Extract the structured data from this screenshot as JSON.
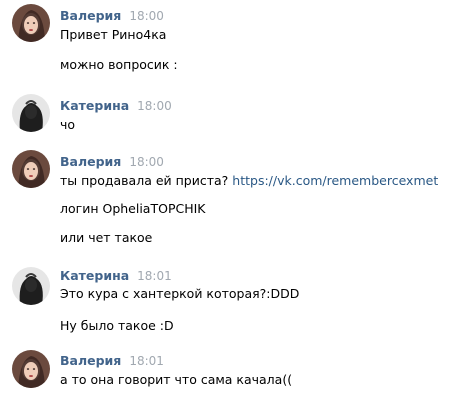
{
  "colors": {
    "author": "#42648b",
    "time": "#a1a8b0",
    "link": "#2a5885",
    "text": "#000000"
  },
  "messages": [
    {
      "author": "Валерия",
      "time": "18:00",
      "avatar": "valeria-avatar",
      "lines": [
        "Привет Рино4ка",
        "можно вопросик :"
      ]
    },
    {
      "author": "Катерина",
      "time": "18:00",
      "avatar": "katerina-avatar",
      "lines": [
        "чо"
      ]
    },
    {
      "author": "Валерия",
      "time": "18:00",
      "avatar": "valeria-avatar",
      "lines": [
        "ты продавала ей приста?",
        "логин OpheliaTOPCHIK",
        "или чет такое"
      ],
      "link": "https://vk.com/remembercexmet"
    },
    {
      "author": "Катерина",
      "time": "18:01",
      "avatar": "katerina-avatar",
      "lines": [
        "Это кура с хантеркой которая?:DDD",
        "Ну было такое :D"
      ]
    },
    {
      "author": "Валерия",
      "time": "18:01",
      "avatar": "valeria-avatar",
      "lines": [
        "а то она говорит что сама качала(("
      ]
    }
  ]
}
